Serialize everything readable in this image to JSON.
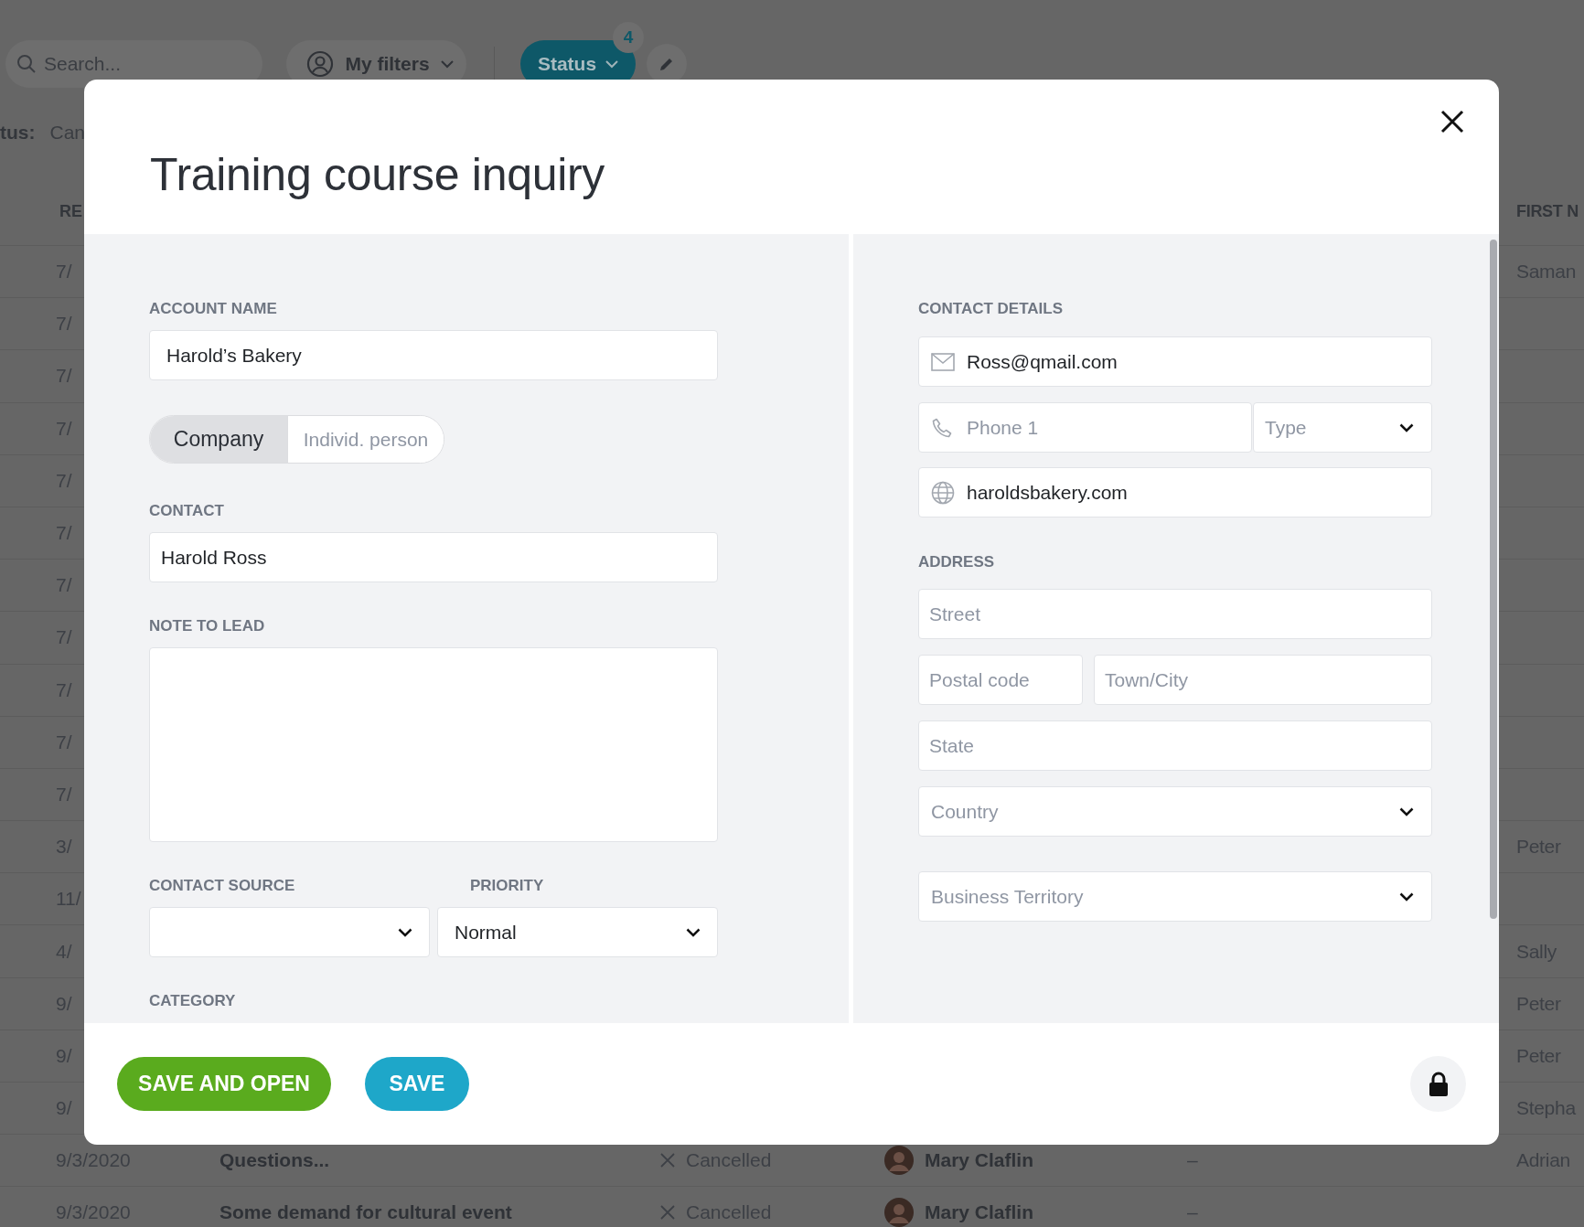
{
  "background": {
    "toolbar": {
      "search": {
        "placeholder": "Search..."
      },
      "filters_button": "My filters",
      "status_button": "Status",
      "status_count": "4"
    },
    "status_filter": {
      "label": "tus:",
      "value": "Can"
    },
    "table": {
      "columns": [
        "RE",
        "FIRST N"
      ],
      "rows": [
        {
          "date": "7/",
          "first_name": "Saman"
        },
        {
          "date": "7/"
        },
        {
          "date": "7/"
        },
        {
          "date": "7/"
        },
        {
          "date": "7/"
        },
        {
          "date": "7/"
        },
        {
          "date": "7/"
        },
        {
          "date": "7/"
        },
        {
          "date": "7/"
        },
        {
          "date": "7/"
        },
        {
          "date": "7/"
        },
        {
          "date": "3/",
          "first_name": "Peter"
        },
        {
          "date": "11/"
        },
        {
          "date": "4/",
          "first_name": "Sally"
        },
        {
          "date": "9/",
          "first_name": "Peter"
        },
        {
          "date": "9/",
          "first_name": "Peter"
        },
        {
          "date": "9/",
          "first_name": "Stepha"
        },
        {
          "date": "9/3/2020",
          "subject": "Questions...",
          "status": "Cancelled",
          "owner": "Mary Claflin",
          "column_5": "–",
          "first_name": "Adrian"
        },
        {
          "date": "9/3/2020",
          "subject": "Some demand for cultural event",
          "status": "Cancelled",
          "owner": "Mary Claflin",
          "column_5": "–"
        }
      ]
    }
  },
  "dialog": {
    "title": "Training course inquiry",
    "account_name": {
      "label": "ACCOUNT NAME",
      "value": "Harold’s Bakery"
    },
    "type_toggle": [
      {
        "label": "Company",
        "selected": true
      },
      {
        "label": "Individ. person",
        "selected": false
      }
    ],
    "contact": {
      "label": "CONTACT",
      "value": "Harold Ross"
    },
    "note": {
      "label": "NOTE TO LEAD"
    },
    "contact_source": {
      "label": "CONTACT SOURCE"
    },
    "priority": {
      "label": "PRIORITY",
      "value": "Normal"
    },
    "category": {
      "label": "CATEGORY"
    },
    "contact_details": {
      "label": "CONTACT DETAILS",
      "email": {
        "value": "Ross@qmail.com"
      },
      "phone": {
        "placeholder": "Phone 1"
      },
      "phone_type": {
        "placeholder": "Type"
      },
      "website": {
        "value": "haroldsbakery.com"
      }
    },
    "address": {
      "label": "ADDRESS",
      "street": {
        "placeholder": "Street"
      },
      "postal_code": {
        "placeholder": "Postal code"
      },
      "city": {
        "placeholder": "Town/City"
      },
      "state": {
        "placeholder": "State"
      },
      "country": {
        "placeholder": "Country"
      }
    },
    "business_territory": {
      "placeholder": "Business Territory"
    },
    "buttons": [
      {
        "label": "SAVE AND OPEN",
        "kind": "primary"
      },
      {
        "label": "SAVE",
        "kind": "secondary"
      }
    ]
  }
}
